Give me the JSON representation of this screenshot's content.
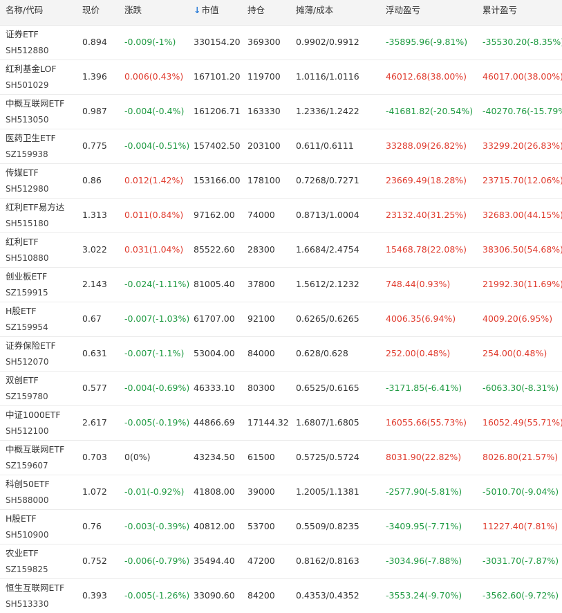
{
  "colors": {
    "up": "#e03b2e",
    "down": "#1e9a41",
    "flat": "#333333",
    "header_bg": "#f4f4f4",
    "sort_icon": "#2f7fd9"
  },
  "header": {
    "name_code": "名称/代码",
    "price": "现价",
    "change": "涨跌",
    "sort_icon": "↓",
    "market_value": "市值",
    "holding": "持仓",
    "cost": "摊薄/成本",
    "float_pnl": "浮动盈亏",
    "cum_pnl": "累计盈亏"
  },
  "rows": [
    {
      "name": "证券ETF",
      "code": "SH512880",
      "price": "0.894",
      "change": "-0.009(-1%)",
      "change_dir": "down",
      "market_value": "330154.20",
      "holding": "369300",
      "cost": "0.9902/0.9912",
      "float_pnl": "-35895.96(-9.81%)",
      "float_dir": "down",
      "cum_pnl": "-35530.20(-8.35%)",
      "cum_dir": "down"
    },
    {
      "name": "红利基金LOF",
      "code": "SH501029",
      "price": "1.396",
      "change": "0.006(0.43%)",
      "change_dir": "up",
      "market_value": "167101.20",
      "holding": "119700",
      "cost": "1.0116/1.0116",
      "float_pnl": "46012.68(38.00%)",
      "float_dir": "up",
      "cum_pnl": "46017.00(38.00%)",
      "cum_dir": "up"
    },
    {
      "name": "中概互联网ETF",
      "code": "SH513050",
      "price": "0.987",
      "change": "-0.004(-0.4%)",
      "change_dir": "down",
      "market_value": "161206.71",
      "holding": "163330",
      "cost": "1.2336/1.2422",
      "float_pnl": "-41681.82(-20.54%)",
      "float_dir": "down",
      "cum_pnl": "-40270.76(-15.79%)",
      "cum_dir": "down"
    },
    {
      "name": "医药卫生ETF",
      "code": "SZ159938",
      "price": "0.775",
      "change": "-0.004(-0.51%)",
      "change_dir": "down",
      "market_value": "157402.50",
      "holding": "203100",
      "cost": "0.611/0.6111",
      "float_pnl": "33288.09(26.82%)",
      "float_dir": "up",
      "cum_pnl": "33299.20(26.83%)",
      "cum_dir": "up"
    },
    {
      "name": "传媒ETF",
      "code": "SH512980",
      "price": "0.86",
      "change": "0.012(1.42%)",
      "change_dir": "up",
      "market_value": "153166.00",
      "holding": "178100",
      "cost": "0.7268/0.7271",
      "float_pnl": "23669.49(18.28%)",
      "float_dir": "up",
      "cum_pnl": "23715.70(12.06%)",
      "cum_dir": "up"
    },
    {
      "name": "红利ETF易方达",
      "code": "SH515180",
      "price": "1.313",
      "change": "0.011(0.84%)",
      "change_dir": "up",
      "market_value": "97162.00",
      "holding": "74000",
      "cost": "0.8713/1.0004",
      "float_pnl": "23132.40(31.25%)",
      "float_dir": "up",
      "cum_pnl": "32683.00(44.15%)",
      "cum_dir": "up"
    },
    {
      "name": "红利ETF",
      "code": "SH510880",
      "price": "3.022",
      "change": "0.031(1.04%)",
      "change_dir": "up",
      "market_value": "85522.60",
      "holding": "28300",
      "cost": "1.6684/2.4754",
      "float_pnl": "15468.78(22.08%)",
      "float_dir": "up",
      "cum_pnl": "38306.50(54.68%)",
      "cum_dir": "up"
    },
    {
      "name": "创业板ETF",
      "code": "SZ159915",
      "price": "2.143",
      "change": "-0.024(-1.11%)",
      "change_dir": "down",
      "market_value": "81005.40",
      "holding": "37800",
      "cost": "1.5612/2.1232",
      "float_pnl": "748.44(0.93%)",
      "float_dir": "up",
      "cum_pnl": "21992.30(11.69%)",
      "cum_dir": "up"
    },
    {
      "name": "H股ETF",
      "code": "SZ159954",
      "price": "0.67",
      "change": "-0.007(-1.03%)",
      "change_dir": "down",
      "market_value": "61707.00",
      "holding": "92100",
      "cost": "0.6265/0.6265",
      "float_pnl": "4006.35(6.94%)",
      "float_dir": "up",
      "cum_pnl": "4009.20(6.95%)",
      "cum_dir": "up"
    },
    {
      "name": "证券保险ETF",
      "code": "SH512070",
      "price": "0.631",
      "change": "-0.007(-1.1%)",
      "change_dir": "down",
      "market_value": "53004.00",
      "holding": "84000",
      "cost": "0.628/0.628",
      "float_pnl": "252.00(0.48%)",
      "float_dir": "up",
      "cum_pnl": "254.00(0.48%)",
      "cum_dir": "up"
    },
    {
      "name": "双创ETF",
      "code": "SZ159780",
      "price": "0.577",
      "change": "-0.004(-0.69%)",
      "change_dir": "down",
      "market_value": "46333.10",
      "holding": "80300",
      "cost": "0.6525/0.6165",
      "float_pnl": "-3171.85(-6.41%)",
      "float_dir": "down",
      "cum_pnl": "-6063.30(-8.31%)",
      "cum_dir": "down"
    },
    {
      "name": "中证1000ETF",
      "code": "SH512100",
      "price": "2.617",
      "change": "-0.005(-0.19%)",
      "change_dir": "down",
      "market_value": "44866.69",
      "holding": "17144.32",
      "cost": "1.6807/1.6805",
      "float_pnl": "16055.66(55.73%)",
      "float_dir": "up",
      "cum_pnl": "16052.49(55.71%)",
      "cum_dir": "up"
    },
    {
      "name": "中概互联网ETF",
      "code": "SZ159607",
      "price": "0.703",
      "change": "0(0%)",
      "change_dir": "flat",
      "market_value": "43234.50",
      "holding": "61500",
      "cost": "0.5725/0.5724",
      "float_pnl": "8031.90(22.82%)",
      "float_dir": "up",
      "cum_pnl": "8026.80(21.57%)",
      "cum_dir": "up"
    },
    {
      "name": "科创50ETF",
      "code": "SH588000",
      "price": "1.072",
      "change": "-0.01(-0.92%)",
      "change_dir": "down",
      "market_value": "41808.00",
      "holding": "39000",
      "cost": "1.2005/1.1381",
      "float_pnl": "-2577.90(-5.81%)",
      "float_dir": "down",
      "cum_pnl": "-5010.70(-9.04%)",
      "cum_dir": "down"
    },
    {
      "name": "H股ETF",
      "code": "SH510900",
      "price": "0.76",
      "change": "-0.003(-0.39%)",
      "change_dir": "down",
      "market_value": "40812.00",
      "holding": "53700",
      "cost": "0.5509/0.8235",
      "float_pnl": "-3409.95(-7.71%)",
      "float_dir": "down",
      "cum_pnl": "11227.40(7.81%)",
      "cum_dir": "up"
    },
    {
      "name": "农业ETF",
      "code": "SZ159825",
      "price": "0.752",
      "change": "-0.006(-0.79%)",
      "change_dir": "down",
      "market_value": "35494.40",
      "holding": "47200",
      "cost": "0.8162/0.8163",
      "float_pnl": "-3034.96(-7.88%)",
      "float_dir": "down",
      "cum_pnl": "-3031.70(-7.87%)",
      "cum_dir": "down"
    },
    {
      "name": "恒生互联网ETF",
      "code": "SH513330",
      "price": "0.393",
      "change": "-0.005(-1.26%)",
      "change_dir": "down",
      "market_value": "33090.60",
      "holding": "84200",
      "cost": "0.4353/0.4352",
      "float_pnl": "-3553.24(-9.70%)",
      "float_dir": "down",
      "cum_pnl": "-3562.60(-9.72%)",
      "cum_dir": "down"
    }
  ]
}
